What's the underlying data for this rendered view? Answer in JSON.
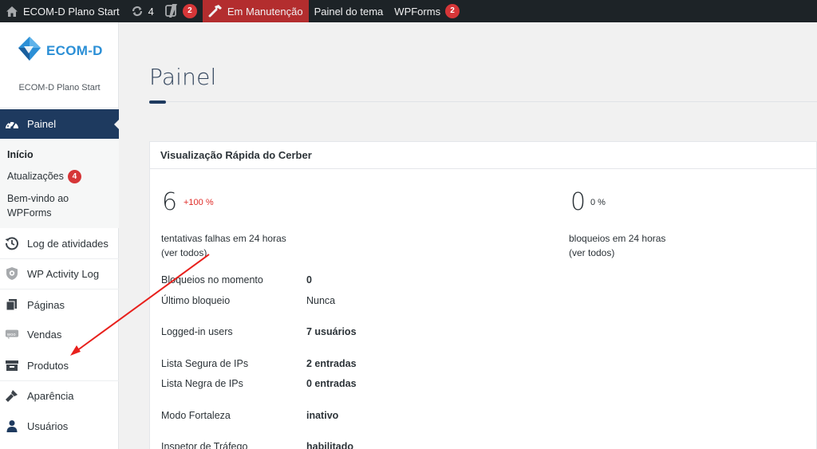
{
  "adminbar": {
    "site_name": "ECOM-D Plano Start",
    "updates_count": "4",
    "yoast_count": "2",
    "maintenance_label": "Em Manutenção",
    "theme_panel_label": "Painel do tema",
    "wpforms_label": "WPForms",
    "wpforms_count": "2"
  },
  "sidebar": {
    "brand_logo_text": "ECOM-D",
    "brand_name": "ECOM-D Plano Start",
    "current": {
      "label": "Painel",
      "icon": "dashboard-icon"
    },
    "submenu": {
      "inicio": "Início",
      "atualizacoes": "Atualizações",
      "atualizacoes_count": "4",
      "bemvindo_line1": "Bem-vindo ao",
      "bemvindo_line2": "WPForms"
    },
    "items": [
      {
        "label": "Log de atividades",
        "icon": "history-icon"
      },
      {
        "label": "WP Activity Log",
        "icon": "shield-icon"
      },
      {
        "label": "Páginas",
        "icon": "pages-icon"
      },
      {
        "label": "Vendas",
        "icon": "woo-icon"
      },
      {
        "label": "Produtos",
        "icon": "archive-box-icon"
      },
      {
        "label": "Aparência",
        "icon": "paintbrush-icon"
      },
      {
        "label": "Usuários",
        "icon": "user-icon"
      }
    ]
  },
  "main": {
    "page_title": "Painel",
    "widget": {
      "title": "Visualização Rápida do Cerber",
      "failed_attempts": {
        "value": "6",
        "change": "+100 %",
        "label": "tentativas falhas em 24 horas",
        "link": "(ver todos)"
      },
      "lockouts": {
        "value": "0",
        "change": "0 %",
        "label": "bloqueios em 24 horas",
        "link": "(ver todos)"
      },
      "rows": [
        {
          "label": "Bloqueios no momento",
          "value": "0"
        },
        {
          "label": "Último bloqueio",
          "value": "Nunca"
        },
        {
          "label": "Logged-in users",
          "value": "7 usuários"
        },
        {
          "label": "Lista Segura de IPs",
          "value": "2 entradas"
        },
        {
          "label": "Lista Negra de IPs",
          "value": "0 entradas"
        },
        {
          "label": "Modo Fortaleza",
          "value": "inativo"
        },
        {
          "label": "Inspetor de Tráfego",
          "value": "habilitado"
        }
      ]
    }
  },
  "colors": {
    "adminbar_bg": "#1d2327",
    "badge_red": "#d63638",
    "maintenance_bg": "#b32d2e",
    "menu_current_bg": "#1e3a5f",
    "positive_change": "#e02b27",
    "annotation_arrow": "#e8201c"
  },
  "annotation": {
    "type": "arrow",
    "color": "#e8201c",
    "points_to": "Produtos"
  }
}
